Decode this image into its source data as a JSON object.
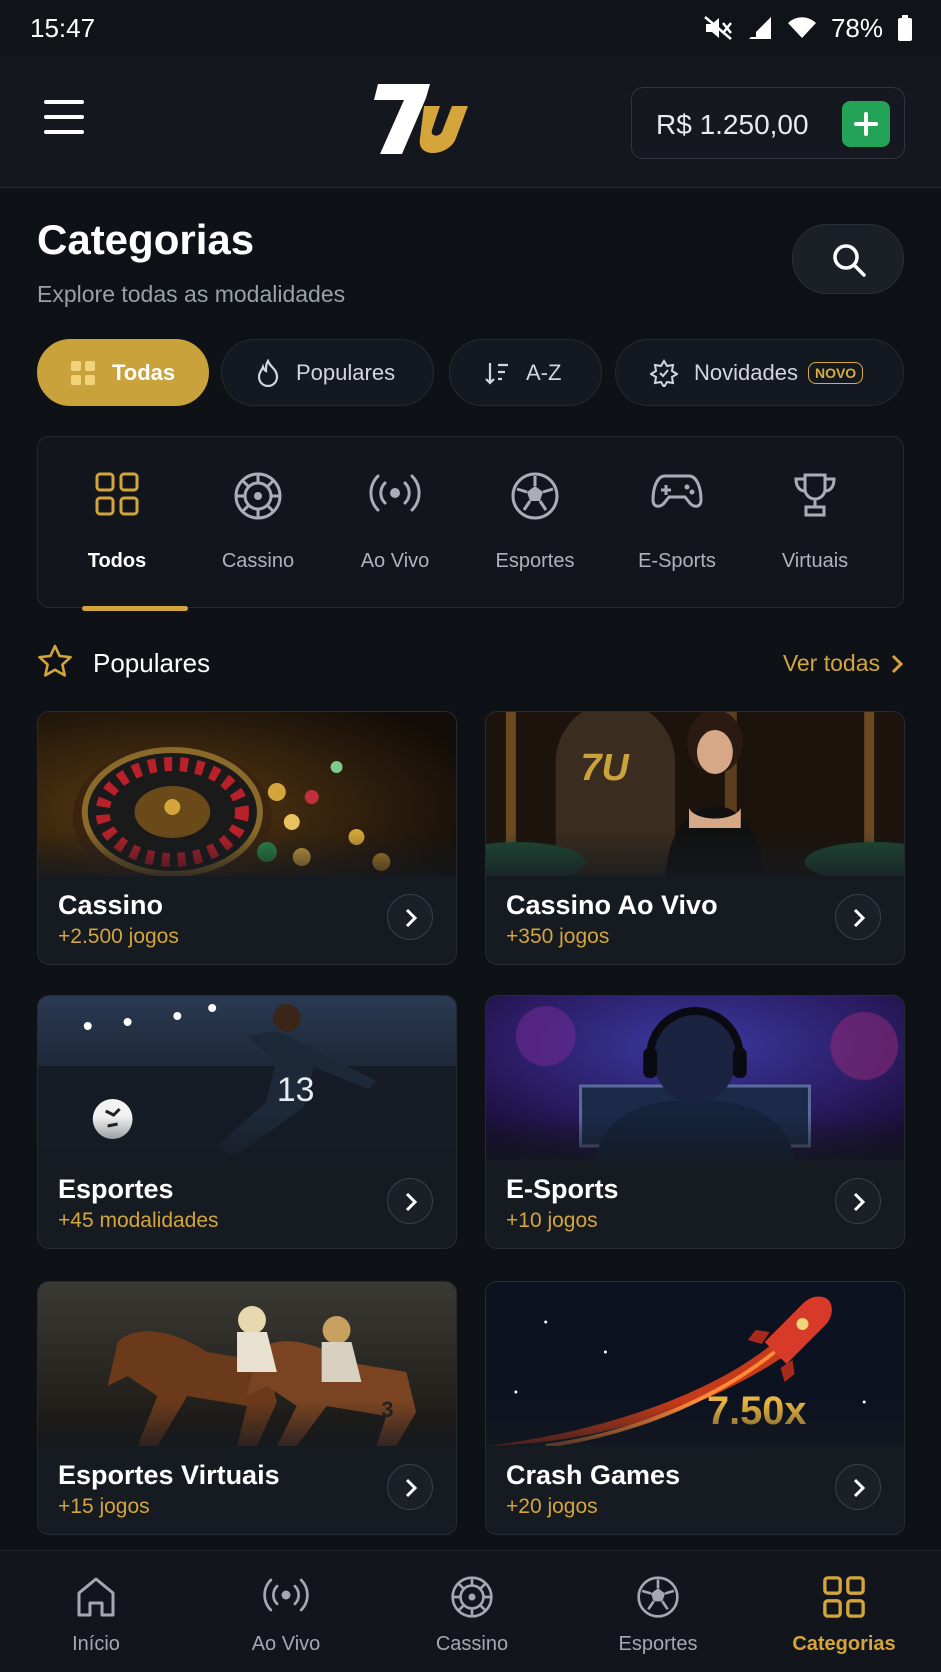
{
  "status": {
    "time": "15:47",
    "battery": "78%"
  },
  "header": {
    "logo": "7U",
    "balance": "R$ 1.250,00"
  },
  "page": {
    "title": "Categorias",
    "subtitle": "Explore todas as modalidades"
  },
  "filters": [
    {
      "label": "Todas",
      "icon": "grid-icon",
      "active": true
    },
    {
      "label": "Populares",
      "icon": "flame-icon"
    },
    {
      "label": "A-Z",
      "icon": "sort-icon"
    },
    {
      "label": "Novidades",
      "icon": "sparkle-badge-icon",
      "badge": "NOVO"
    }
  ],
  "categories": [
    {
      "label": "Todos",
      "icon": "grid-icon",
      "active": true
    },
    {
      "label": "Cassino",
      "icon": "roulette-icon"
    },
    {
      "label": "Ao Vivo",
      "icon": "broadcast-icon"
    },
    {
      "label": "Esportes",
      "icon": "soccer-ball-icon"
    },
    {
      "label": "E-Sports",
      "icon": "gamepad-icon"
    },
    {
      "label": "Virtuais",
      "icon": "trophy-icon"
    }
  ],
  "popular": {
    "title": "Populares",
    "link": "Ver todas",
    "cards": [
      {
        "title": "Cassino",
        "subtitle": "+2.500 jogos"
      },
      {
        "title": "Cassino Ao Vivo",
        "subtitle": "+350 jogos",
        "image_text": "7U"
      },
      {
        "title": "Esportes",
        "subtitle": "+45 modalidades",
        "image_text": "13"
      },
      {
        "title": "E-Sports",
        "subtitle": "+10 jogos"
      },
      {
        "title": "Esportes Virtuais",
        "subtitle": "+15 jogos",
        "image_text": "3"
      },
      {
        "title": "Crash Games",
        "subtitle": "+20 jogos",
        "image_text": "7.50x"
      }
    ]
  },
  "nav": [
    {
      "label": "Início",
      "icon": "home-icon"
    },
    {
      "label": "Ao Vivo",
      "icon": "broadcast-icon"
    },
    {
      "label": "Cassino",
      "icon": "roulette-icon"
    },
    {
      "label": "Esportes",
      "icon": "soccer-ball-icon"
    },
    {
      "label": "Categorias",
      "icon": "grid-icon",
      "active": true
    }
  ],
  "colors": {
    "accent": "#d4a53a",
    "background": "#0e1116",
    "add": "#23a357"
  }
}
